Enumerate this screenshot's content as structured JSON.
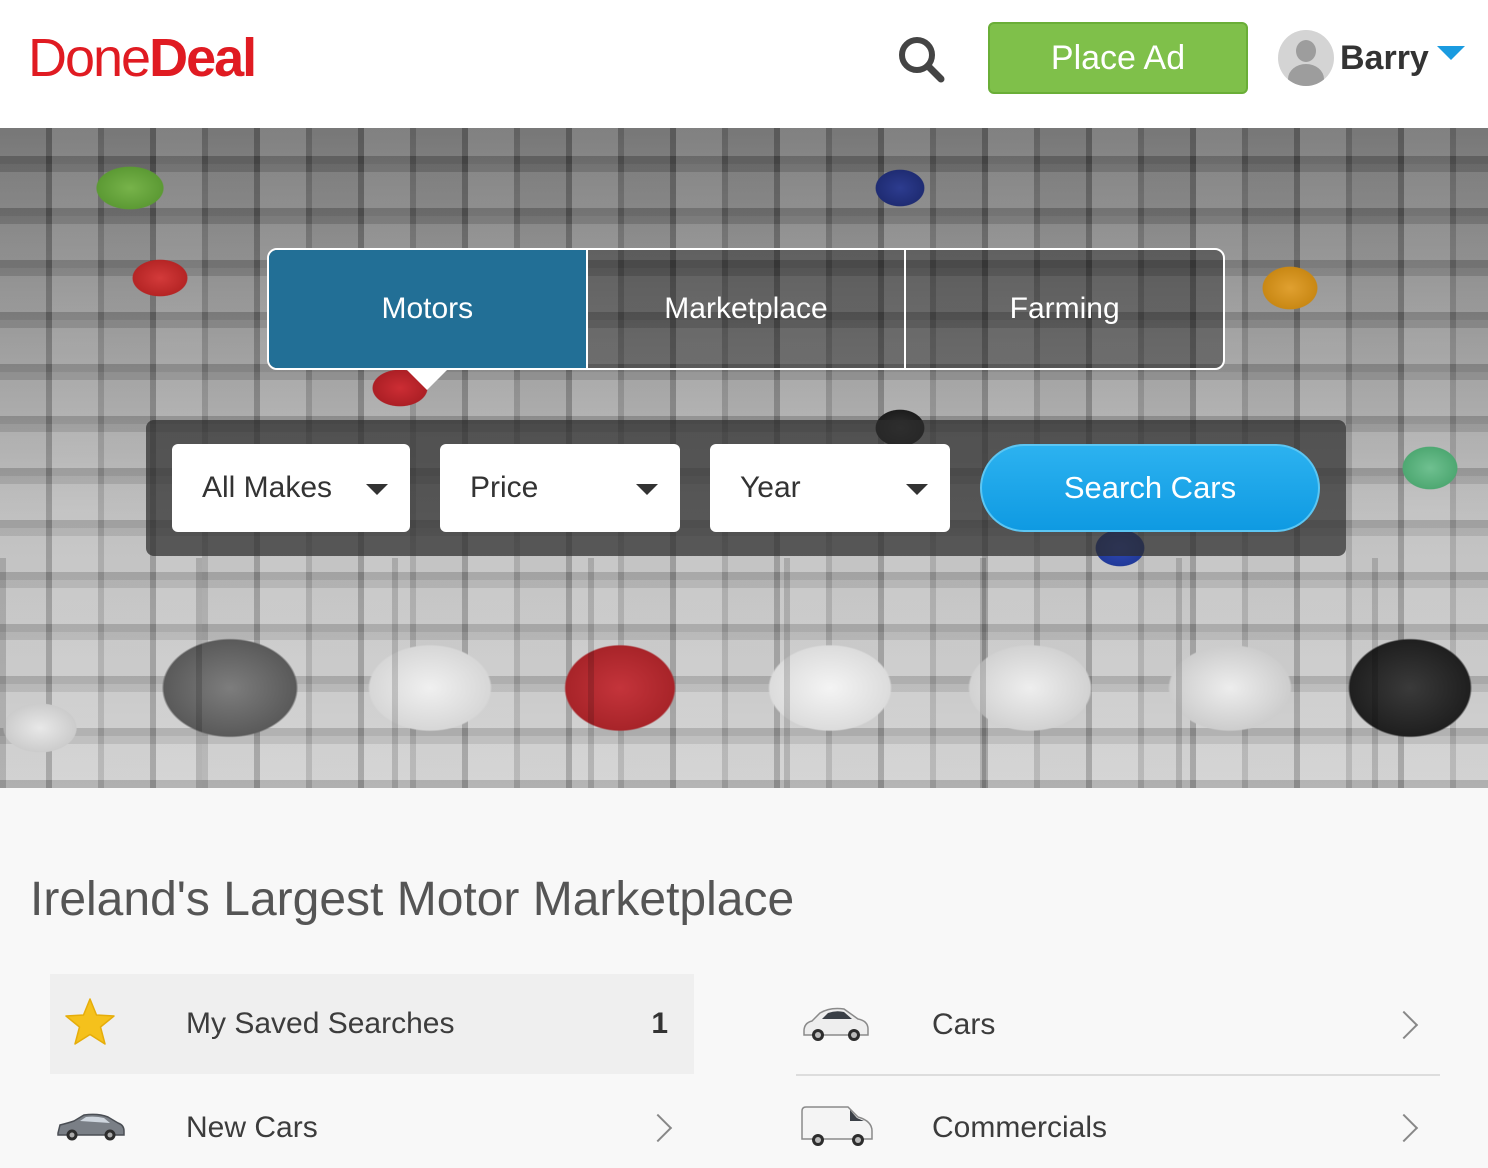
{
  "header": {
    "logo_part1": "Done",
    "logo_part2": "Deal",
    "place_ad_label": "Place Ad",
    "user_name": "Barry",
    "brand_color": "#e01b22"
  },
  "tabs": [
    {
      "label": "Motors",
      "active": true
    },
    {
      "label": "Marketplace",
      "active": false
    },
    {
      "label": "Farming",
      "active": false
    }
  ],
  "search": {
    "makes": "All Makes",
    "price": "Price",
    "year": "Year",
    "button_label": "Search Cars"
  },
  "main": {
    "title": "Ireland's Largest Motor Marketplace",
    "links": {
      "saved": {
        "label": "My Saved Searches",
        "count": "1",
        "icon": "star-icon"
      },
      "new_cars": {
        "label": "New Cars",
        "icon": "hatchback-car-icon"
      },
      "cars": {
        "label": "Cars",
        "icon": "car-icon"
      },
      "commercials": {
        "label": "Commercials",
        "icon": "van-icon"
      }
    }
  },
  "colors": {
    "active_tab": "#226f96",
    "place_ad": "#7fc04a",
    "search_button": "#1aa3e8",
    "star": "#f5c11c"
  }
}
